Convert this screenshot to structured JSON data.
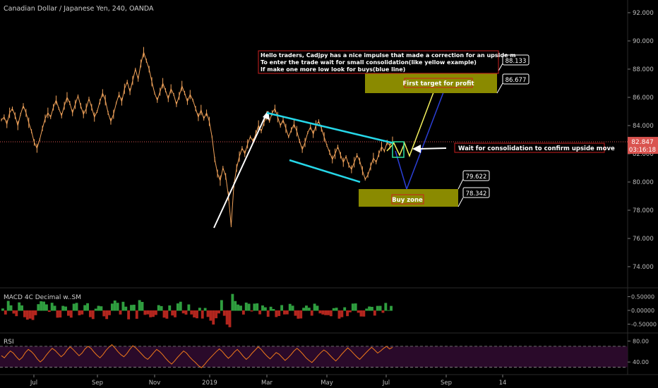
{
  "header": {
    "title": "Canadian Dollar / Japanese Yen, 240, OANDA"
  },
  "colors": {
    "background": "#000000",
    "candles": "#f0a25a",
    "channel": "#26d7e8",
    "impulse": "#ffffff",
    "projection_yellow": "#f5f15c",
    "projection_blue": "#2b3fd6",
    "zone_fill": "#8a8a00",
    "price_line": "#d9534f",
    "macd_up": "#2f9e3f",
    "macd_down": "#b3261e",
    "rsi_line": "#f07a1a",
    "rsi_band": "#2a0a2a",
    "annotation_border": "#cc2020"
  },
  "annotation": {
    "lines": [
      "Hello traders, Cadjpy has a nice impulse that made a correction for an upside m",
      "To enter the trade wait for small consolidation(like yellow example)",
      "If make one more low look for buys(blue line)"
    ]
  },
  "labels": {
    "first_target": "First target for profit",
    "buy_zone": "Buy zone",
    "wait_note": "Wait for consolidation to  confirm  upside move"
  },
  "callouts": {
    "top1": "88.133",
    "top2": "86.677",
    "bottom1": "79.622",
    "bottom2": "78.342"
  },
  "price_tag": {
    "value": "82.847",
    "countdown": "03:16:18"
  },
  "indicators": {
    "macd_title": "MACD 4C Decimal w..SM",
    "rsi_title": "RSI"
  },
  "chart_data": {
    "type": "line",
    "title": "Canadian Dollar / Japanese Yen, 240, OANDA",
    "xlabel": "",
    "ylabel": "",
    "x_ticks": [
      "Jul",
      "Sep",
      "Nov",
      "2019",
      "Mar",
      "May",
      "Jul",
      "Sep",
      "14"
    ],
    "y_ticks": [
      "92.000",
      "90.000",
      "88.000",
      "86.000",
      "84.000",
      "82.000",
      "80.000",
      "78.000",
      "76.000",
      "74.000"
    ],
    "ylim": [
      73.0,
      92.5
    ],
    "grid": false,
    "last_price": 82.847,
    "series": [
      {
        "values": [
          84.4,
          84.6,
          84.1,
          84.9,
          85.2,
          84.7,
          84.0,
          84.8,
          85.4,
          84.9,
          84.2,
          83.6,
          82.8,
          82.4,
          83.0,
          83.8,
          84.5,
          84.9,
          84.6,
          85.3,
          85.8,
          85.2,
          84.7,
          85.4,
          86.0,
          85.6,
          84.9,
          85.5,
          86.1,
          85.4,
          84.8,
          85.2,
          85.9,
          85.3,
          84.6,
          85.0,
          85.7,
          86.3,
          85.8,
          84.9,
          84.3,
          84.8,
          85.6,
          86.2,
          85.7,
          86.6,
          87.1,
          86.4,
          87.2,
          88.0,
          87.3,
          88.4,
          89.2,
          88.6,
          88.0,
          87.1,
          86.3,
          85.8,
          86.4,
          87.0,
          86.5,
          85.9,
          86.6,
          86.2,
          85.5,
          86.1,
          86.8,
          86.3,
          85.7,
          86.2,
          85.8,
          85.2,
          84.6,
          85.1,
          84.5,
          84.9,
          84.3,
          83.2,
          81.6,
          80.6,
          80.1,
          81.0,
          80.4,
          79.0,
          76.9,
          79.8,
          81.0,
          81.8,
          82.4,
          82.0,
          82.7,
          83.2,
          82.9,
          83.4,
          84.0,
          83.6,
          84.2,
          84.7,
          84.3,
          84.9,
          85.2,
          84.6,
          84.0,
          84.4,
          83.8,
          83.2,
          83.7,
          84.1,
          83.6,
          82.9,
          82.3,
          82.8,
          83.5,
          83.9,
          83.4,
          84.0,
          84.3,
          83.8,
          83.2,
          82.6,
          82.1,
          81.6,
          82.0,
          82.5,
          81.9,
          81.4,
          81.8,
          81.2,
          80.9,
          81.4,
          81.9,
          81.5,
          80.8,
          80.2,
          80.5,
          81.1,
          81.7,
          81.4,
          82.0,
          82.5,
          82.2,
          82.8,
          82.6,
          82.85
        ]
      }
    ],
    "annotations": [
      "Hello traders, Cadjpy has a nice impulse that made a correction for an upside m",
      "First target for profit",
      "Buy zone",
      "Wait for consolidation to  confirm  upside move"
    ],
    "zones": [
      {
        "label": "First target for profit",
        "from": 86.677,
        "to": 88.133
      },
      {
        "label": "Buy zone",
        "from": 78.342,
        "to": 79.622
      }
    ],
    "macd": {
      "title": "MACD 4C Decimal w..SM",
      "y_ticks": [
        "0.50000",
        "0.00000",
        "-0.50000"
      ],
      "ylim": [
        -0.72,
        0.72
      ]
    },
    "rsi": {
      "title": "RSI",
      "y_ticks": [
        "80.00",
        "40.00"
      ],
      "band": [
        30,
        70
      ],
      "ylim": [
        20,
        90
      ],
      "values": [
        52,
        48,
        55,
        61,
        57,
        50,
        44,
        49,
        58,
        64,
        60,
        54,
        46,
        40,
        45,
        53,
        60,
        66,
        62,
        56,
        50,
        55,
        63,
        69,
        64,
        58,
        52,
        57,
        65,
        70,
        66,
        59,
        53,
        48,
        54,
        62,
        68,
        73,
        67,
        60,
        54,
        50,
        56,
        64,
        71,
        67,
        61,
        55,
        49,
        45,
        51,
        58,
        64,
        60,
        54,
        47,
        41,
        36,
        42,
        49,
        55,
        61,
        57,
        50,
        44,
        39,
        33,
        29,
        35,
        42,
        48,
        54,
        60,
        65,
        60,
        53,
        47,
        52,
        59,
        64,
        58,
        51,
        45,
        50,
        57,
        63,
        69,
        64,
        57,
        51,
        46,
        52,
        58,
        55,
        49,
        43,
        48,
        54,
        61,
        66,
        61,
        55,
        48,
        43,
        39,
        45,
        52,
        58,
        63,
        59,
        53,
        47,
        42,
        48,
        55,
        61,
        67,
        62,
        56,
        50,
        45,
        51,
        57,
        63,
        68,
        63,
        57,
        61,
        66,
        70,
        65,
        68
      ]
    }
  }
}
